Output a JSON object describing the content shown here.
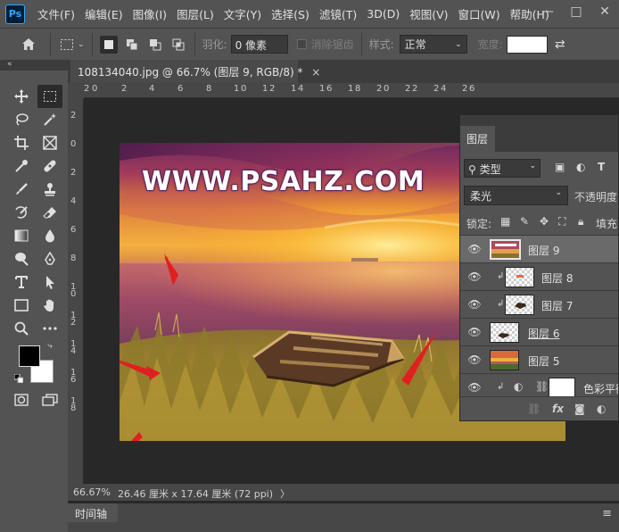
{
  "app": {
    "logo": "Ps"
  },
  "menu": [
    "文件(F)",
    "编辑(E)",
    "图像(I)",
    "图层(L)",
    "文字(Y)",
    "选择(S)",
    "滤镜(T)",
    "3D(D)",
    "视图(V)",
    "窗口(W)",
    "帮助(H)"
  ],
  "window_controls": {
    "minimize": "—",
    "maximize": "□",
    "close": "✕"
  },
  "options": {
    "feather_label": "羽化:",
    "feather_value": "0 像素",
    "antialias_label": "消除锯齿",
    "style_label": "样式:",
    "style_value": "正常",
    "width_label": "宽度:"
  },
  "tools_collapse": "«",
  "document": {
    "tab_title": "108134040.jpg @ 66.7% (图层 9, RGB/8) *",
    "close": "×"
  },
  "ruler_h": [
    "2",
    "0",
    "2",
    "4",
    "6",
    "8",
    "1",
    "0",
    "1",
    "2",
    "1",
    "4",
    "1",
    "6",
    "1",
    "8",
    "2",
    "0",
    "2",
    "2",
    "2",
    "4",
    "2",
    "6"
  ],
  "ruler_v": [
    "2",
    "0",
    "2",
    "4",
    "6",
    "8",
    "1",
    "0",
    "1",
    "2",
    "1",
    "4",
    "1",
    "6",
    "1",
    "8"
  ],
  "canvas": {
    "watermark": "WWW.PSAHZ.COM"
  },
  "status": {
    "zoom": "66.67%",
    "doc_info": "26.46 厘米 x 17.64 厘米 (72 ppi)",
    "arrow": "〉"
  },
  "timeline": {
    "tab": "时间轴",
    "menu": "≡"
  },
  "layers_panel": {
    "tab": "图层",
    "filter_kind": "类型",
    "blend_mode": "柔光",
    "opacity_label": "不透明度",
    "lock_label": "锁定:",
    "fill_label": "填充",
    "layers": [
      {
        "name": "图层 9",
        "selected": true,
        "clipped": false,
        "thumb": "photo-small"
      },
      {
        "name": "图层 8",
        "selected": false,
        "clipped": true,
        "thumb": "checker-boat-top"
      },
      {
        "name": "图层 7",
        "selected": false,
        "clipped": true,
        "thumb": "checker-boat"
      },
      {
        "name": "图层 6",
        "selected": false,
        "clipped": false,
        "thumb": "checker"
      },
      {
        "name": "图层 5",
        "selected": false,
        "clipped": false,
        "thumb": "sunset"
      },
      {
        "name": "色彩平衡",
        "selected": false,
        "clipped": true,
        "thumb": "white"
      }
    ]
  }
}
